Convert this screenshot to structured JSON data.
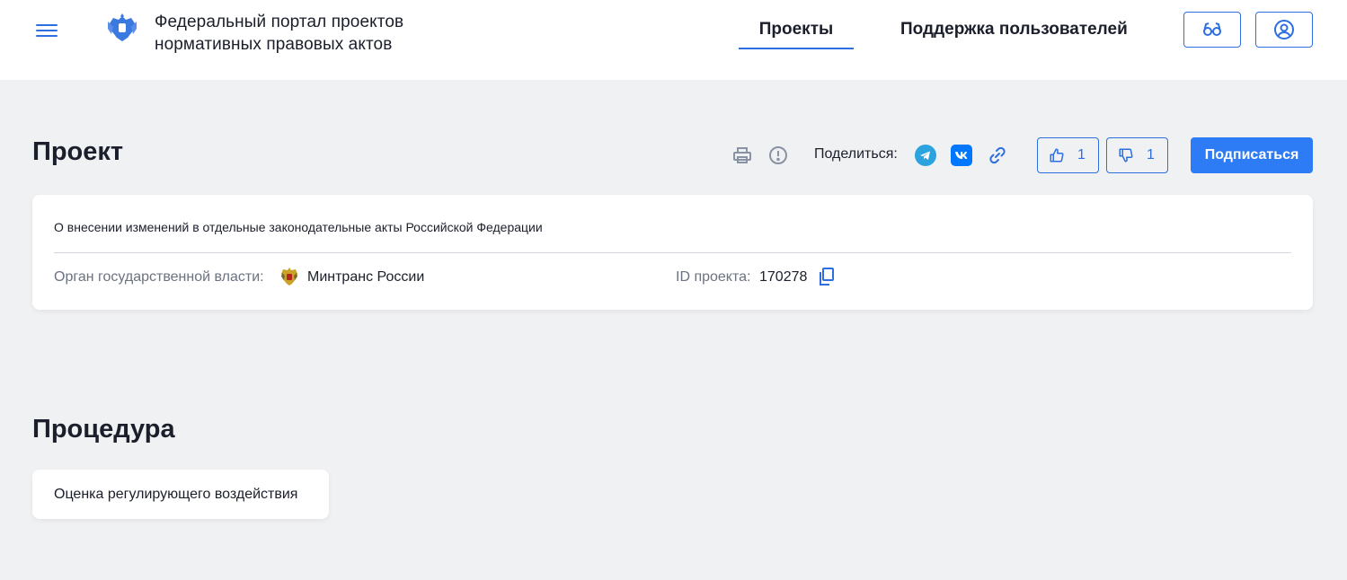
{
  "header": {
    "portal_title_line1": "Федеральный портал проектов",
    "portal_title_line2": "нормативных правовых актов",
    "nav": [
      {
        "label": "Проекты",
        "active": true
      },
      {
        "label": "Поддержка пользователей",
        "active": false
      }
    ],
    "icons": {
      "menu": "hamburger-icon",
      "emblem": "russian-emblem-icon",
      "accessibility": "glasses-icon",
      "user": "user-icon"
    }
  },
  "project": {
    "heading": "Проект",
    "share_label": "Поделиться:",
    "likes": "1",
    "dislikes": "1",
    "subscribe_label": "Подписаться",
    "title": "О внесении изменений в отдельные законодательные акты Российской Федерации",
    "organ_label": "Орган государственной власти:",
    "organ_value": "Минтранс России",
    "id_label": "ID проекта:",
    "id_value": "170278",
    "icons": [
      "print-icon",
      "warning-icon",
      "telegram-icon",
      "vk-icon",
      "link-icon",
      "thumbs-up-icon",
      "thumbs-down-icon",
      "copy-icon",
      "ministry-emblem-icon"
    ]
  },
  "procedure": {
    "heading": "Процедура",
    "stage": "Оценка регулирующего воздействия"
  },
  "colors": {
    "accent": "#2d6fe0",
    "button": "#2d7cf6",
    "background": "#f0f1f3",
    "text": "#1b1f2b",
    "muted": "#6b7280",
    "telegram": "#2aa3df",
    "vk": "#0077ff"
  }
}
